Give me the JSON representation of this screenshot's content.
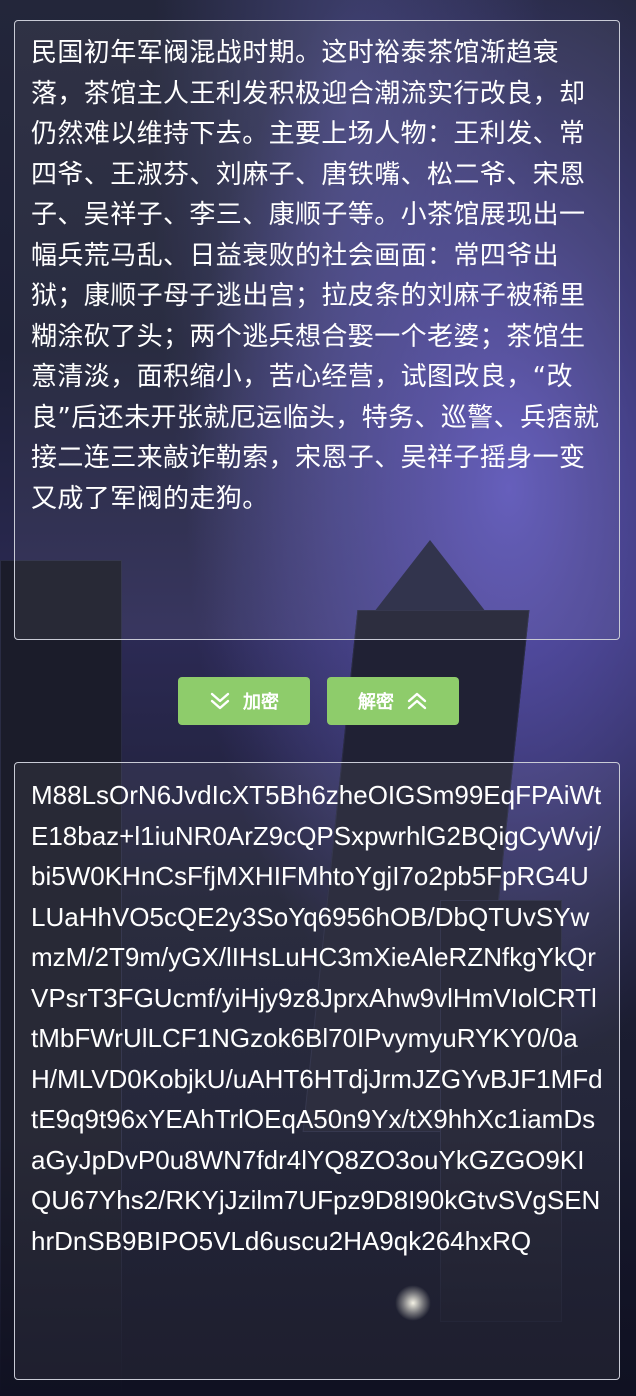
{
  "plaintext": "民国初年军阀混战时期。这时裕泰茶馆渐趋衰落，茶馆主人王利发积极迎合潮流实行改良，却仍然难以维持下去。主要上场人物：王利发、常四爷、王淑芬、刘麻子、唐铁嘴、松二爷、宋恩子、吴祥子、李三、康顺子等。小茶馆展现出一幅兵荒马乱、日益衰败的社会画面：常四爷出狱；康顺子母子逃出宫；拉皮条的刘麻子被稀里糊涂砍了头；两个逃兵想合娶一个老婆；茶馆生意清淡，面积缩小，苦心经营，试图改良，“改良”后还未开张就厄运临头，特务、巡警、兵痞就接二连三来敲诈勒索，宋恩子、吴祥子摇身一变又成了军阀的走狗。",
  "buttons": {
    "encrypt_label": "加密",
    "encrypt_icon": "double-chevron-down-icon",
    "decrypt_label": "解密",
    "decrypt_icon": "double-chevron-up-icon",
    "color": "#8ecc6b"
  },
  "ciphertext": "M88LsOrN6JvdIcXT5Bh6zheOIGSm99EqFPAiWtE18baz+l1iuNR0ArZ9cQPSxpwrhlG2BQigCyWvj/bi5W0KHnCsFfjMXHIFMhtoYgjI7o2pb5FpRG4ULUaHhVO5cQE2y3SoYq6956hOB/DbQTUvSYwmzM/2T9m/yGX/lIHsLuHC3mXieAleRZNfkgYkQrVPsrT3FGUcmf/yiHjy9z8JprxAhw9vlHmVIolCRTltMbFWrUlLCF1NGzok6Bl70IPvymyuRYKY0/0aH/MLVD0KobjkU/uAHT6HTdjJrmJZGYvBJF1MFdtE9q9t96xYEAhTrlOEqA50n9Yx/tX9hhXc1iamDsaGyJpDvP0u8WN7fdr4lYQ8ZO3ouYkGZGO9KIQU67Yhs2/RKYjJzilm7UFpz9D8I90kGtvSVgSENhrDnSB9BIPO5VLd6uscu2HA9qk264hxRQ"
}
